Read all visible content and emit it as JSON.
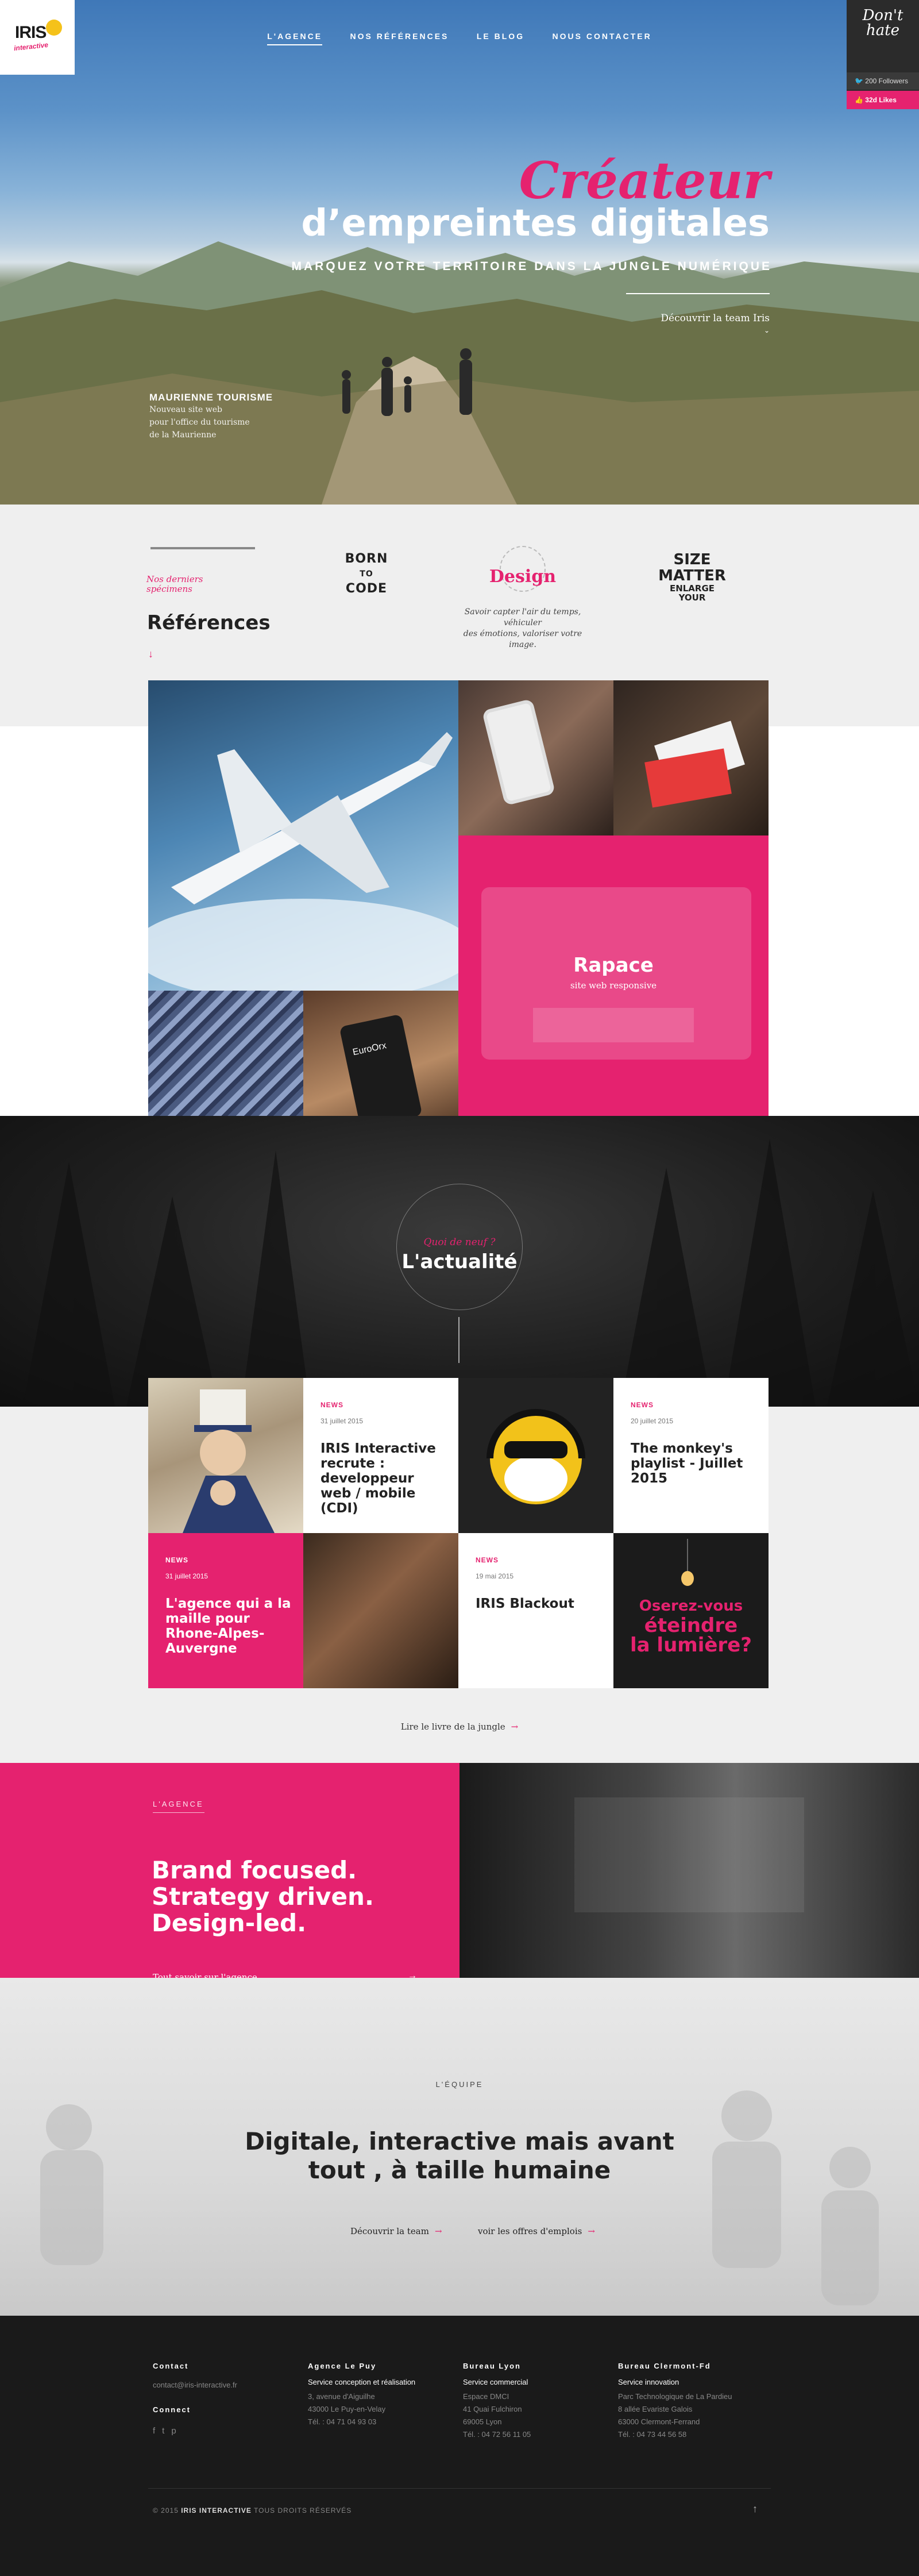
{
  "brand": {
    "logo_text": "IRIS",
    "logo_sub": "interactive"
  },
  "nav": [
    {
      "label": "L'agence"
    },
    {
      "label": "Nos références"
    },
    {
      "label": "Le blog"
    },
    {
      "label": "Nous contacter"
    }
  ],
  "social": {
    "signature": "Don't hate",
    "twitter": "200 Followers",
    "facebook": "32d Likes"
  },
  "hero": {
    "title_accent": "Créateur",
    "title_main": "d’empreintes digitales",
    "subtitle": "Marquez votre territoire dans la jungle numérique",
    "cta": "Découvrir la team Iris",
    "caption_title": "Maurienne Tourisme",
    "caption_desc": [
      "Nouveau site web",
      "pour l'office du tourisme",
      "de la Maurienne"
    ]
  },
  "references": {
    "kicker_line1": "Nos derniers",
    "kicker_line2": "spécimens",
    "title": "Références",
    "badge_born": [
      "BORN",
      "TO",
      "CODE"
    ],
    "badge_design_title": "Design",
    "badge_design_text": [
      "Savoir capter l'air du temps, véhiculer",
      "des émotions, valoriser votre image."
    ],
    "badge_size": [
      "SIZE",
      "MATTER",
      "ENLARGE",
      "YOUR"
    ],
    "featured_title": "Rapace",
    "featured_sub": "site web responsive",
    "euro_label": "EuroOrx"
  },
  "news": {
    "kicker": "Quoi de neuf ?",
    "title": "L'actualité",
    "items": [
      {
        "label": "News",
        "date": "31 juillet 2015",
        "title": "IRIS Interactive recrute : developpeur web / mobile (CDI)"
      },
      {
        "label": "News",
        "date": "20 juillet 2015",
        "title": "The monkey's playlist - Juillet 2015"
      },
      {
        "label": "News",
        "date": "31 juillet 2015",
        "title": "L'agence qui a la maille pour Rhone-Alpes-Auvergne"
      },
      {
        "label": "News",
        "date": "19 mai 2015",
        "title": "IRIS Blackout"
      }
    ],
    "poster_lines": [
      "Oserez-vous",
      "éteindre",
      "la lumière?"
    ],
    "more_link": "Lire le livre de la jungle"
  },
  "agence": {
    "kicker": "L'agence",
    "title": [
      "Brand focused.",
      "Strategy driven.",
      "Design-led."
    ],
    "link": "Tout savoir sur l'agence"
  },
  "equipe": {
    "kicker": "L'équipe",
    "title_line1": "Digitale, interactive mais avant",
    "title_line2": "tout , à taille humaine",
    "link1": "Découvrir la team",
    "link2": "voir les offres d'emplois"
  },
  "footer": {
    "contact_title": "Contact",
    "contact_email": "contact@iris-interactive.fr",
    "connect_title": "Connect",
    "offices": [
      {
        "title": "Agence Le Puy",
        "service": "Service conception et réalisation",
        "lines": [
          "3, avenue d'Aiguilhe",
          "43000 Le Puy-en-Velay",
          "Tél. : 04 71 04 93 03"
        ]
      },
      {
        "title": "Bureau Lyon",
        "service": "Service commercial",
        "lines": [
          "Espace DMCI",
          "41 Quai Fulchiron",
          "69005 Lyon",
          "Tél. : 04 72 56 11 05"
        ]
      },
      {
        "title": "Bureau Clermont-Fd",
        "service": "Service innovation",
        "lines": [
          "Parc Technologique de La Pardieu",
          "8 allée Evariste Galois",
          "63000 Clermont-Ferrand",
          "Tél. : 04 73 44 56 58"
        ]
      }
    ],
    "copyright_pre": "© 2015",
    "copyright_brand": "IRIS INTERACTIVE",
    "copyright_post": "TOUS DROITS RÉSERVÉS"
  },
  "colors": {
    "accent": "#e5226f",
    "dark": "#1a1a1a",
    "light": "#efefef"
  }
}
